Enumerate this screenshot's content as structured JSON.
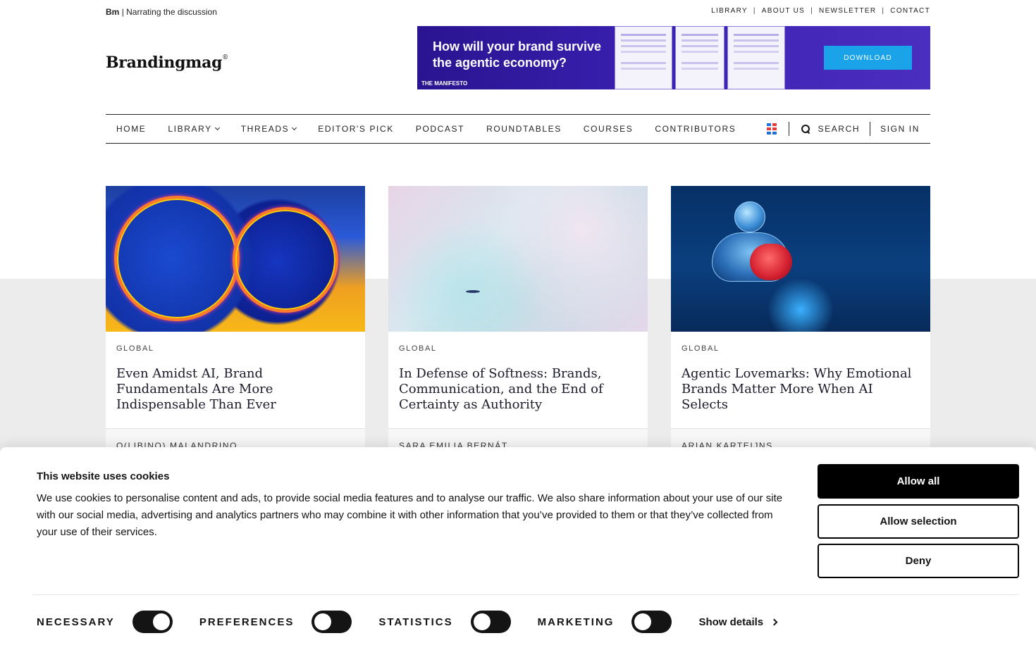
{
  "topbar": {
    "brand_short": "Bm",
    "tagline": "| Narrating the discussion",
    "links": [
      "LIBRARY",
      "ABOUT US",
      "NEWSLETTER",
      "CONTACT"
    ],
    "separator": "|"
  },
  "logo": {
    "text": "Brandingmag",
    "mark": "®"
  },
  "ad": {
    "headline": "How will your brand survive the agentic economy?",
    "brand": "THE MANIFESTO",
    "button": "DOWNLOAD"
  },
  "nav": {
    "items": [
      {
        "label": "HOME",
        "dropdown": false
      },
      {
        "label": "LIBRARY",
        "dropdown": true
      },
      {
        "label": "THREADS",
        "dropdown": true
      },
      {
        "label": "EDITOR'S PICK",
        "dropdown": false
      },
      {
        "label": "PODCAST",
        "dropdown": false
      },
      {
        "label": "ROUNDTABLES",
        "dropdown": false
      },
      {
        "label": "COURSES",
        "dropdown": false
      },
      {
        "label": "CONTRIBUTORS",
        "dropdown": false
      }
    ],
    "search_label": "SEARCH",
    "signin_label": "SIGN IN",
    "grid_icon_colors": [
      "#e23b3b",
      "#1f6fd6"
    ]
  },
  "cards": [
    {
      "region": "GLOBAL",
      "title": "Even Amidst AI, Brand Fundamentals Are More Indispensable Than Ever",
      "author": "O(LIBINO) MALANDRINO"
    },
    {
      "region": "GLOBAL",
      "title": "In Defense of Softness: Brands, Communication, and the End of Certainty as Authority",
      "author": "SARA EMILIA BERNÁT"
    },
    {
      "region": "GLOBAL",
      "title": "Agentic Lovemarks: Why Emotional Brands Matter More When AI Selects",
      "author": "ARIAN KARTEIJNS"
    }
  ],
  "cookie": {
    "title": "This website uses cookies",
    "text": "We use cookies to personalise content and ads, to provide social media features and to analyse our traffic. We also share information about your use of our site with our social media, advertising and analytics partners who may combine it with other information that you’ve provided to them or that they’ve collected from your use of their services.",
    "buttons": {
      "allow_all": "Allow all",
      "allow_selection": "Allow selection",
      "deny": "Deny"
    },
    "toggles": [
      {
        "label": "NECESSARY",
        "on": true
      },
      {
        "label": "PREFERENCES",
        "on": false
      },
      {
        "label": "STATISTICS",
        "on": false
      },
      {
        "label": "MARKETING",
        "on": false
      }
    ],
    "show_details": "Show details"
  }
}
